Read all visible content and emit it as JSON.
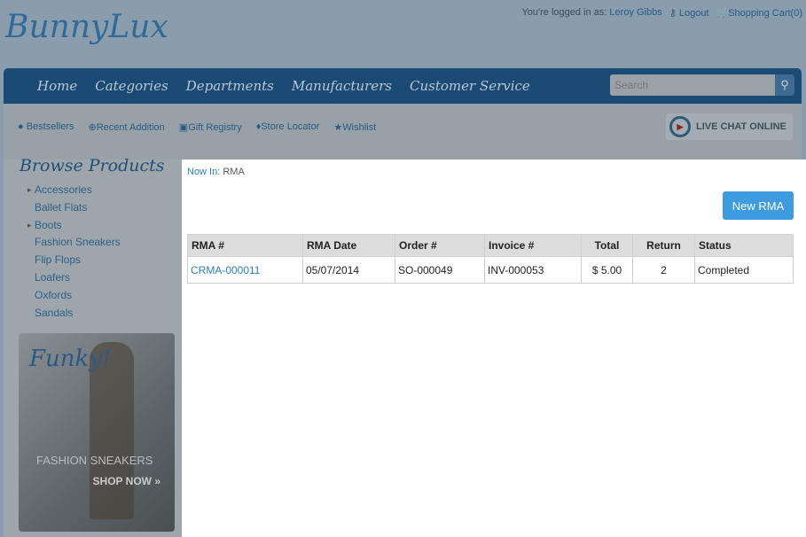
{
  "logo": "BunnyLux",
  "topbar": {
    "logged_in": "You're logged in as:",
    "user": "Leroy Gibbs",
    "logout": "Logout",
    "cart": "Shopping Cart(0)"
  },
  "nav": {
    "items": [
      "Home",
      "Categories",
      "Departments",
      "Manufacturers",
      "Customer Service"
    ],
    "search_placeholder": "Search"
  },
  "subnav": {
    "links": [
      "Bestsellers",
      "Recent Addition",
      "Gift Registry",
      "Store Locator",
      "Wishlist"
    ],
    "chat": "LIVE CHAT ONLINE"
  },
  "sidebar": {
    "title": "Browse Products",
    "categories": [
      "Accessories",
      "Ballet Flats",
      "Boots",
      "Fashion Sneakers",
      "Flip Flops",
      "Loafers",
      "Oxfords",
      "Sandals"
    ],
    "banner": {
      "title": "Funky!",
      "subtitle": "FASHION SNEAKERS",
      "cta": "SHOP NOW »"
    }
  },
  "content": {
    "breadcrumb_label": "Now In:",
    "breadcrumb_page": "RMA",
    "new_button": "New RMA",
    "columns": [
      "RMA #",
      "RMA Date",
      "Order #",
      "Invoice #",
      "Total",
      "Return",
      "Status"
    ],
    "rows": [
      {
        "rma": "CRMA-000011",
        "date": "05/07/2014",
        "order": "SO-000049",
        "invoice": "INV-000053",
        "total": "$ 5.00",
        "return": "2",
        "status": "Completed"
      }
    ]
  }
}
